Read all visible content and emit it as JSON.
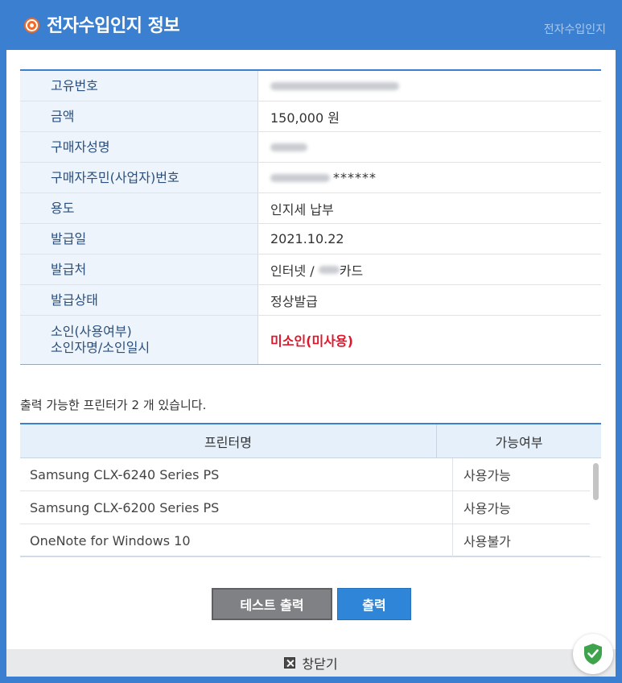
{
  "window": {
    "title": "전자수입인지 정보",
    "title_right": "전자수입인지"
  },
  "info": {
    "rows": [
      {
        "label": "고유번호",
        "value": ""
      },
      {
        "label": "금액",
        "value": "150,000 원"
      },
      {
        "label": "구매자성명",
        "value": ""
      },
      {
        "label": "구매자주민(사업자)번호",
        "value": "******"
      },
      {
        "label": "용도",
        "value": "인지세 납부"
      },
      {
        "label": "발급일",
        "value": "2021.10.22"
      },
      {
        "label": "발급처",
        "value_prefix": "인터넷 / ",
        "value_suffix": "카드"
      },
      {
        "label": "발급상태",
        "value": "정상발급"
      },
      {
        "label_line1": "소인(사용여부)",
        "label_line2": "소인자명/소인일시",
        "value": "미소인(미사용)"
      }
    ]
  },
  "printers": {
    "message": "출력 가능한 프린터가 2 개 있습니다.",
    "headers": [
      "프린터명",
      "가능여부"
    ],
    "rows": [
      {
        "name": "Samsung CLX-6240 Series PS",
        "status": "사용가능"
      },
      {
        "name": "Samsung CLX-6200 Series PS",
        "status": "사용가능"
      },
      {
        "name": "OneNote for Windows 10",
        "status": "사용불가"
      }
    ]
  },
  "buttons": {
    "test_print": "테스트 출력",
    "print": "출력"
  },
  "footer": {
    "close_label": "창닫기"
  },
  "colors": {
    "accent": "#3a7fd0",
    "warning_text": "#e0162b",
    "badge_green": "#3fa34d"
  }
}
